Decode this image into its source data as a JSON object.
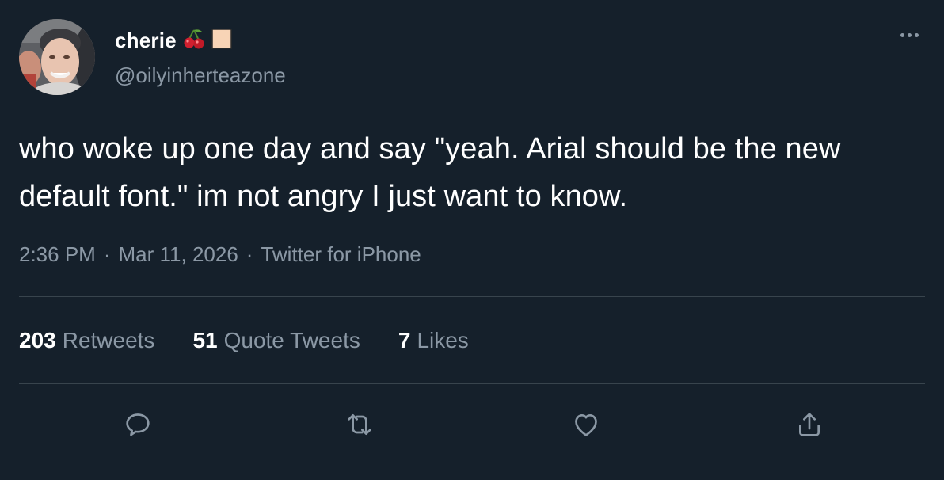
{
  "author": {
    "display_name": "cherie",
    "emojis": [
      "cherries-emoji",
      "peach-square-emoji"
    ],
    "handle": "@oilyinherteazone"
  },
  "tweet": {
    "text": "who woke up one day and say \"yeah. Arial should be the new default font.\" im not angry I just want to know."
  },
  "meta": {
    "time": "2:36 PM",
    "separator": "·",
    "date": "Mar 11, 2026",
    "source": "Twitter for iPhone"
  },
  "stats": {
    "retweets_count": "203",
    "retweets_label": "Retweets",
    "quotes_count": "51",
    "quotes_label": "Quote Tweets",
    "likes_count": "7",
    "likes_label": "Likes"
  },
  "actions": [
    "reply-icon",
    "retweet-icon",
    "like-icon",
    "share-icon"
  ],
  "colors": {
    "background": "#15202b",
    "text_primary": "#ffffff",
    "text_secondary": "#8b98a5",
    "divider": "#38444d"
  }
}
